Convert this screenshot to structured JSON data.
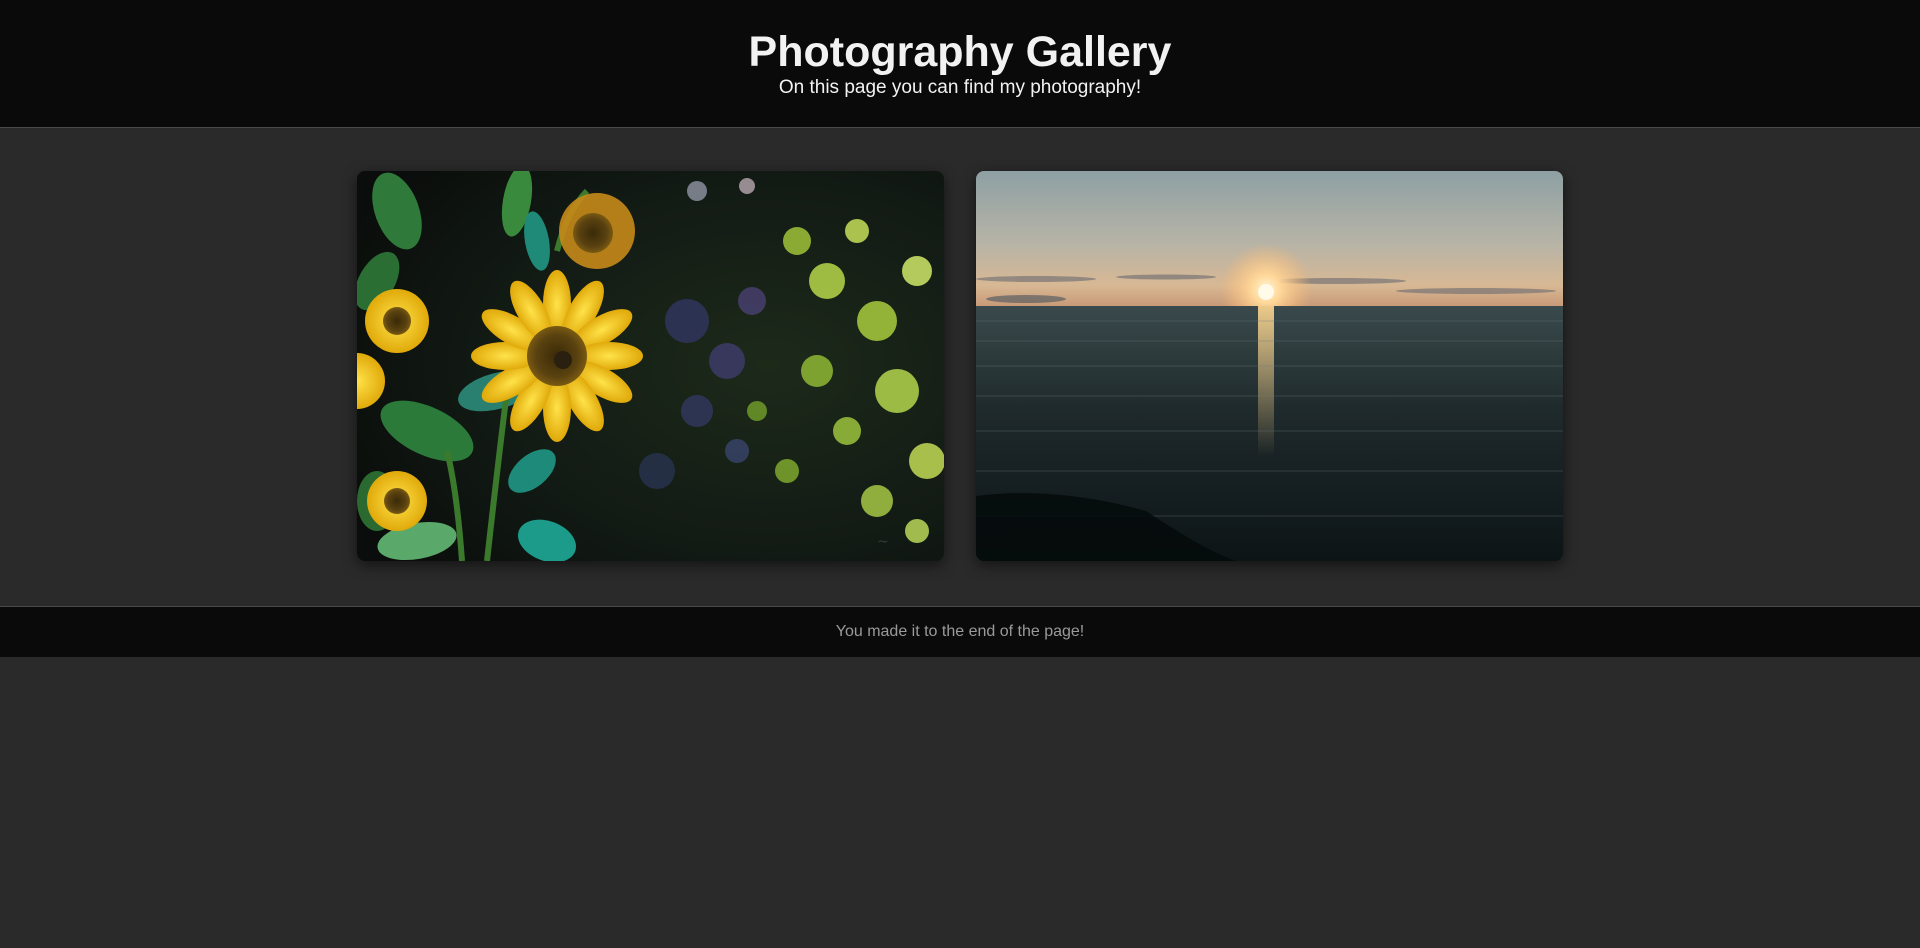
{
  "header": {
    "title": "Photography Gallery",
    "subtitle": "On this page you can find my photography!"
  },
  "gallery": {
    "photos": [
      {
        "subject": "sunflowers",
        "icon": "sunflower-photo"
      },
      {
        "subject": "ocean sunset",
        "icon": "sunset-photo"
      }
    ]
  },
  "footer": {
    "text": "You made it to the end of the page!"
  },
  "colors": {
    "header_bg": "#0a0a0a",
    "page_bg": "#2a2a2a",
    "title": "#f2f2f2",
    "footer_text": "#9a9a9a"
  }
}
